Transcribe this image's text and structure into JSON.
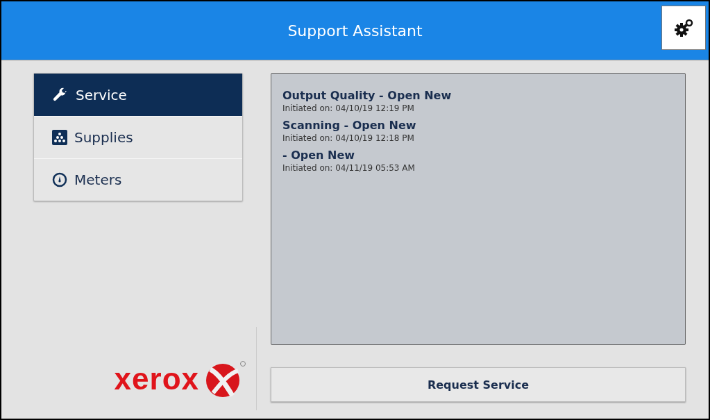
{
  "header": {
    "title": "Support Assistant"
  },
  "menu": [
    {
      "label": "Service",
      "kind": "wrench",
      "selected": true
    },
    {
      "label": "Supplies",
      "kind": "supplies",
      "selected": false
    },
    {
      "label": "Meters",
      "kind": "meter",
      "selected": false
    }
  ],
  "requests": [
    {
      "title": "Output Quality - Open New",
      "initiated": "Initiated on: 04/10/19 12:19 PM"
    },
    {
      "title": "Scanning - Open New",
      "initiated": "Initiated on: 04/10/19 12:18 PM"
    },
    {
      "title": "- Open New",
      "initiated": "Initiated on: 04/11/19 05:53 AM"
    }
  ],
  "logo": {
    "wordmark": "xerox"
  },
  "request_button": {
    "label": "Request Service"
  }
}
